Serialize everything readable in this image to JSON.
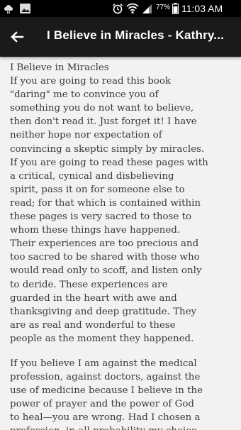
{
  "status_bar": {
    "battery_percent": "77%",
    "time": "11:03 AM",
    "icons": [
      "cloud-icon",
      "image-icon",
      "alarm-icon",
      "wifi-icon",
      "signal-icon",
      "battery-icon"
    ]
  },
  "app_bar": {
    "back_icon": "arrow-left-icon",
    "title": "I Believe in Miracles - Kathry..."
  },
  "book": {
    "paragraph_1": " I Believe in Miracles\n If you are going to read this book\n\"daring\" me to convince you of\nsomething you do not want to believe,\nthen don't read it. Just forget it! I have\nneither hope nor expectation of\nconvincing a skeptic simply by miracles.\nIf you are going to read these pages with\na critical, cynical and disbelieving\nspirit, pass it on for someone else to\nread; for that which is contained within\nthese pages is very sacred to those to\nwhom these things have happened.\nTheir experiences are too precious and\ntoo sacred to be shared with those who\nwould read only to scoff, and listen only\nto deride. These experiences are\nguarded in the heart with awe and\nthanksgiving and deep gratitude. They\nare as real and wonderful to these\npeople as the moment they happened.",
    "paragraph_2": " If you believe I am against the medical\nprofession, against doctors, against the\nuse of medicine because I believe in the\npower of prayer and the power of God\nto heal—you are wrong. Had I chosen a\nprofession, in all probability my choice"
  },
  "colors": {
    "status_bar_bg": "#000000",
    "app_bar_bg": "#1a1a1a",
    "page_bg": "#f2f2f2",
    "text": "#3a3a3a"
  }
}
